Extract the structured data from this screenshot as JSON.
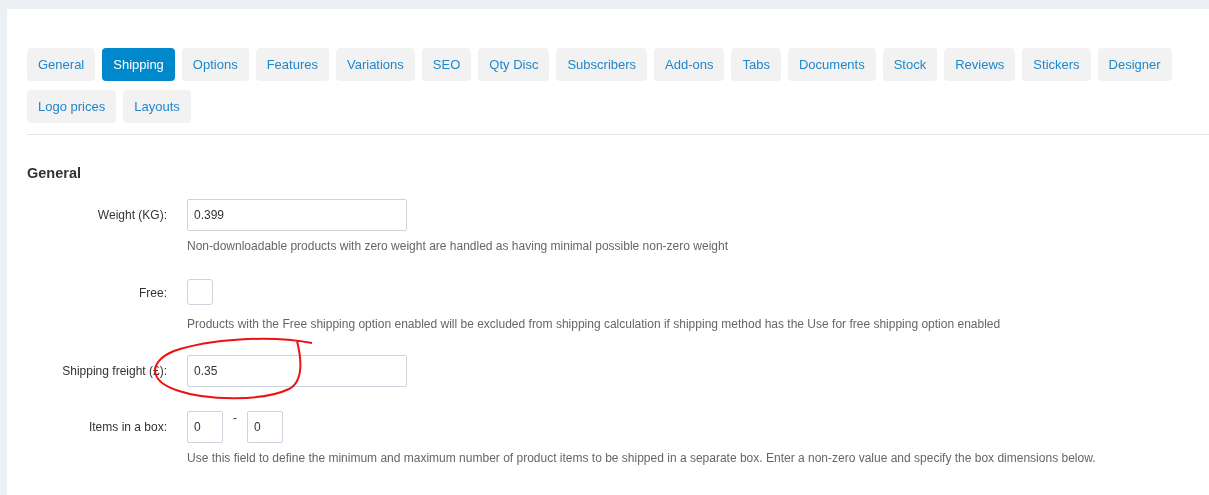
{
  "tabs": [
    {
      "label": "General",
      "selected": false
    },
    {
      "label": "Shipping",
      "selected": true
    },
    {
      "label": "Options",
      "selected": false
    },
    {
      "label": "Features",
      "selected": false
    },
    {
      "label": "Variations",
      "selected": false
    },
    {
      "label": "SEO",
      "selected": false
    },
    {
      "label": "Qty Disc",
      "selected": false
    },
    {
      "label": "Subscribers",
      "selected": false
    },
    {
      "label": "Add-ons",
      "selected": false
    },
    {
      "label": "Tabs",
      "selected": false
    },
    {
      "label": "Documents",
      "selected": false
    },
    {
      "label": "Stock",
      "selected": false
    },
    {
      "label": "Reviews",
      "selected": false
    },
    {
      "label": "Stickers",
      "selected": false
    },
    {
      "label": "Designer",
      "selected": false
    },
    {
      "label": "Logo prices",
      "selected": false
    },
    {
      "label": "Layouts",
      "selected": false
    }
  ],
  "section": {
    "title": "General"
  },
  "fields": [
    {
      "kind": "text",
      "label": "Weight (KG):",
      "value": "0.399",
      "help": "Non-downloadable products with zero weight are handled as having minimal possible non-zero weight"
    },
    {
      "kind": "checkbox",
      "label": "Free:",
      "checked": false,
      "help": "Products with the Free shipping option enabled will be excluded from shipping calculation if shipping method has the Use for free shipping option enabled"
    },
    {
      "kind": "text",
      "label": "Shipping freight (£):",
      "value": "0.35",
      "annotated": true
    },
    {
      "kind": "range",
      "label": "Items in a box:",
      "min": "0",
      "separator": "-",
      "max": "0",
      "help": "Use this field to define the minimum and maximum number of product items to be shipped in a separate box. Enter a non-zero value and specify the box dimensions below."
    }
  ]
}
